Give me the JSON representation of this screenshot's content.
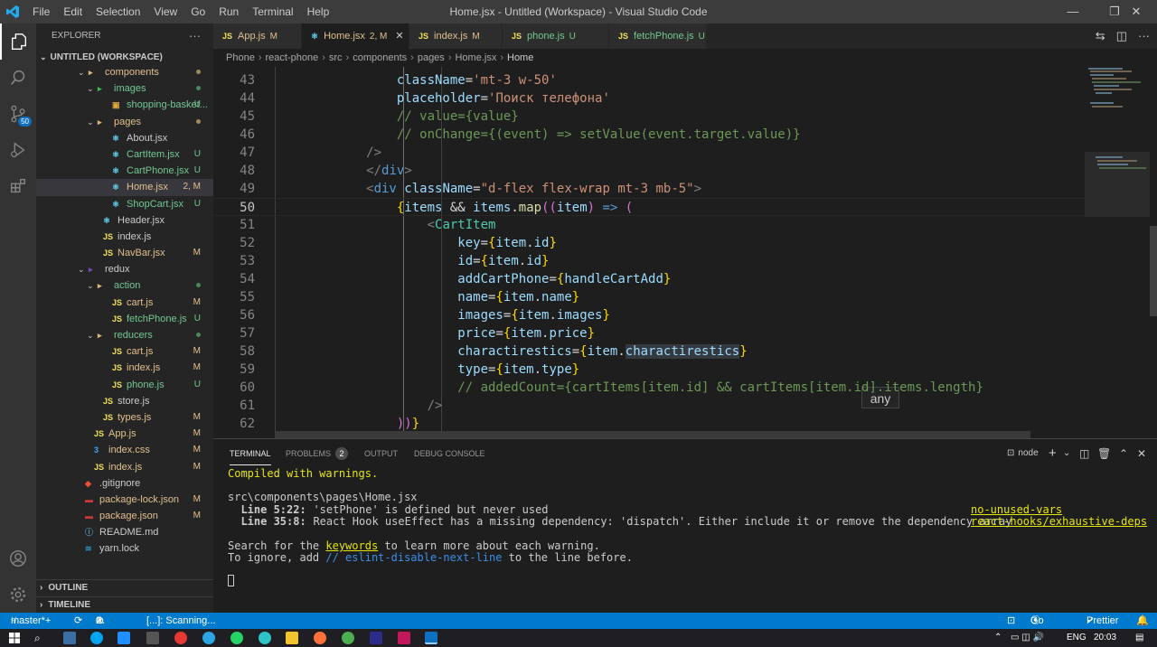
{
  "titlebar": {
    "menu": [
      "File",
      "Edit",
      "Selection",
      "View",
      "Go",
      "Run",
      "Terminal",
      "Help"
    ],
    "title": "Home.jsx - Untitled (Workspace) - Visual Studio Code",
    "min": "—",
    "max": "❐",
    "close": "✕"
  },
  "activity": {
    "scm_badge": "50"
  },
  "explorer": {
    "title": "EXPLORER",
    "more": "···",
    "workspace": "UNTITLED (WORKSPACE)",
    "items": [
      {
        "label": "components",
        "type": "folder",
        "icon": "folder",
        "status": "dot-yellow"
      },
      {
        "label": "images",
        "type": "folder",
        "icon": "folder-image",
        "status": "dot-green"
      },
      {
        "label": "shopping-basket...",
        "type": "file",
        "icon": "image-file",
        "status": "U"
      },
      {
        "label": "pages",
        "type": "folder",
        "icon": "folder",
        "status": "dot-yellow"
      },
      {
        "label": "About.jsx",
        "type": "file",
        "icon": "react",
        "status": ""
      },
      {
        "label": "CartItem.jsx",
        "type": "file",
        "icon": "react",
        "status": "U"
      },
      {
        "label": "CartPhone.jsx",
        "type": "file",
        "icon": "react",
        "status": "U"
      },
      {
        "label": "Home.jsx",
        "type": "file",
        "icon": "react",
        "status": "2, M"
      },
      {
        "label": "ShopCart.jsx",
        "type": "file",
        "icon": "react",
        "status": "U"
      },
      {
        "label": "Header.jsx",
        "type": "file",
        "icon": "react",
        "status": ""
      },
      {
        "label": "index.js",
        "type": "file",
        "icon": "js",
        "status": ""
      },
      {
        "label": "NavBar.jsx",
        "type": "file",
        "icon": "js",
        "status": "M"
      },
      {
        "label": "redux",
        "type": "folder",
        "icon": "folder-redux",
        "status": ""
      },
      {
        "label": "action",
        "type": "folder",
        "icon": "folder",
        "status": "dot-green"
      },
      {
        "label": "cart.js",
        "type": "file",
        "icon": "js",
        "status": "M"
      },
      {
        "label": "fetchPhone.js",
        "type": "file",
        "icon": "js",
        "status": "U"
      },
      {
        "label": "reducers",
        "type": "folder",
        "icon": "folder",
        "status": "dot-green"
      },
      {
        "label": "cart.js",
        "type": "file",
        "icon": "js",
        "status": "M"
      },
      {
        "label": "index.js",
        "type": "file",
        "icon": "js",
        "status": "M"
      },
      {
        "label": "phone.js",
        "type": "file",
        "icon": "js",
        "status": "U"
      },
      {
        "label": "store.js",
        "type": "file",
        "icon": "js",
        "status": ""
      },
      {
        "label": "types.js",
        "type": "file",
        "icon": "js",
        "status": "M"
      },
      {
        "label": "App.js",
        "type": "file",
        "icon": "js",
        "status": "M"
      },
      {
        "label": "index.css",
        "type": "file",
        "icon": "css",
        "status": "M"
      },
      {
        "label": "index.js",
        "type": "file",
        "icon": "js",
        "status": "M"
      },
      {
        "label": ".gitignore",
        "type": "file",
        "icon": "git",
        "status": ""
      },
      {
        "label": "package-lock.json",
        "type": "file",
        "icon": "npm",
        "status": "M"
      },
      {
        "label": "package.json",
        "type": "file",
        "icon": "npm",
        "status": "M"
      },
      {
        "label": "README.md",
        "type": "file",
        "icon": "md",
        "status": ""
      },
      {
        "label": "yarn.lock",
        "type": "file",
        "icon": "yarn",
        "status": ""
      }
    ],
    "outline": "OUTLINE",
    "timeline": "TIMELINE"
  },
  "tabs": [
    {
      "label": "App.js",
      "status": "M",
      "icon": "JS"
    },
    {
      "label": "Home.jsx",
      "status": "2, M",
      "icon": "react",
      "active": true
    },
    {
      "label": "index.js",
      "status": "M",
      "icon": "JS"
    },
    {
      "label": "phone.js",
      "status": "U",
      "icon": "JS"
    },
    {
      "label": "fetchPhone.js",
      "status": "U",
      "icon": "JS"
    }
  ],
  "breadcrumb": [
    "Phone",
    "react-phone",
    "src",
    "components",
    "pages",
    "Home.jsx",
    "Home"
  ],
  "editor": {
    "lines": [
      {
        "n": "43",
        "tokens": [
          {
            "t": "                className",
            "c": "attr"
          },
          {
            "t": "=",
            "c": "op"
          },
          {
            "t": "'mt-3 w-50'",
            "c": "str"
          }
        ]
      },
      {
        "n": "44",
        "tokens": [
          {
            "t": "                placeholder",
            "c": "attr"
          },
          {
            "t": "=",
            "c": "op"
          },
          {
            "t": "'Поиск телефона'",
            "c": "str"
          }
        ]
      },
      {
        "n": "45",
        "tokens": [
          {
            "t": "                // value={value}",
            "c": "cmt"
          }
        ]
      },
      {
        "n": "46",
        "tokens": [
          {
            "t": "                // onChange={(event) => setValue(event.target.value)}",
            "c": "cmt"
          }
        ]
      },
      {
        "n": "47",
        "tokens": [
          {
            "t": "            />",
            "c": "tag"
          }
        ]
      },
      {
        "n": "48",
        "tokens": [
          {
            "t": "            </",
            "c": "tag"
          },
          {
            "t": "div",
            "c": "tagname"
          },
          {
            "t": ">",
            "c": "tag"
          }
        ]
      },
      {
        "n": "49",
        "tokens": [
          {
            "t": "            <",
            "c": "tag"
          },
          {
            "t": "div",
            "c": "tagname"
          },
          {
            "t": " className",
            "c": "attr"
          },
          {
            "t": "=",
            "c": "op"
          },
          {
            "t": "\"d-flex flex-wrap mt-3 mb-5\"",
            "c": "str"
          },
          {
            "t": ">",
            "c": "tag"
          }
        ]
      },
      {
        "n": "50",
        "cur": true,
        "tokens": [
          {
            "t": "                {",
            "c": "brace"
          },
          {
            "t": "items",
            "c": "var"
          },
          {
            "t": " && ",
            "c": "op"
          },
          {
            "t": "items",
            "c": "var"
          },
          {
            "t": ".",
            "c": "op"
          },
          {
            "t": "map",
            "c": "fn"
          },
          {
            "t": "((",
            "c": "paren"
          },
          {
            "t": "item",
            "c": "var"
          },
          {
            "t": ")",
            "c": "paren"
          },
          {
            "t": " => ",
            "c": "kw"
          },
          {
            "t": "(",
            "c": "paren"
          }
        ]
      },
      {
        "n": "51",
        "tokens": [
          {
            "t": "                    <",
            "c": "tag"
          },
          {
            "t": "CartItem",
            "c": "comp"
          }
        ]
      },
      {
        "n": "52",
        "tokens": [
          {
            "t": "                        key",
            "c": "attr"
          },
          {
            "t": "=",
            "c": "op"
          },
          {
            "t": "{",
            "c": "brace"
          },
          {
            "t": "item",
            "c": "var"
          },
          {
            "t": ".",
            "c": "op"
          },
          {
            "t": "id",
            "c": "var"
          },
          {
            "t": "}",
            "c": "brace"
          }
        ]
      },
      {
        "n": "53",
        "tokens": [
          {
            "t": "                        id",
            "c": "attr"
          },
          {
            "t": "=",
            "c": "op"
          },
          {
            "t": "{",
            "c": "brace"
          },
          {
            "t": "item",
            "c": "var"
          },
          {
            "t": ".",
            "c": "op"
          },
          {
            "t": "id",
            "c": "var"
          },
          {
            "t": "}",
            "c": "brace"
          }
        ]
      },
      {
        "n": "54",
        "tokens": [
          {
            "t": "                        addCartPhone",
            "c": "attr"
          },
          {
            "t": "=",
            "c": "op"
          },
          {
            "t": "{",
            "c": "brace"
          },
          {
            "t": "handleCartAdd",
            "c": "var"
          },
          {
            "t": "}",
            "c": "brace"
          }
        ]
      },
      {
        "n": "55",
        "tokens": [
          {
            "t": "                        name",
            "c": "attr"
          },
          {
            "t": "=",
            "c": "op"
          },
          {
            "t": "{",
            "c": "brace"
          },
          {
            "t": "item",
            "c": "var"
          },
          {
            "t": ".",
            "c": "op"
          },
          {
            "t": "name",
            "c": "var"
          },
          {
            "t": "}",
            "c": "brace"
          }
        ]
      },
      {
        "n": "56",
        "tokens": [
          {
            "t": "                        images",
            "c": "attr"
          },
          {
            "t": "=",
            "c": "op"
          },
          {
            "t": "{",
            "c": "brace"
          },
          {
            "t": "item",
            "c": "var"
          },
          {
            "t": ".",
            "c": "op"
          },
          {
            "t": "images",
            "c": "var"
          },
          {
            "t": "}",
            "c": "brace"
          }
        ]
      },
      {
        "n": "57",
        "tokens": [
          {
            "t": "                        price",
            "c": "attr"
          },
          {
            "t": "=",
            "c": "op"
          },
          {
            "t": "{",
            "c": "brace"
          },
          {
            "t": "item",
            "c": "var"
          },
          {
            "t": ".",
            "c": "op"
          },
          {
            "t": "price",
            "c": "var"
          },
          {
            "t": "}",
            "c": "brace"
          }
        ]
      },
      {
        "n": "58",
        "tokens": [
          {
            "t": "                        charactirestics",
            "c": "attr"
          },
          {
            "t": "=",
            "c": "op"
          },
          {
            "t": "{",
            "c": "brace"
          },
          {
            "t": "item",
            "c": "var"
          },
          {
            "t": ".",
            "c": "op"
          },
          {
            "t": "charactirestics",
            "c": "hl"
          },
          {
            "t": "}",
            "c": "brace"
          }
        ]
      },
      {
        "n": "59",
        "tokens": [
          {
            "t": "                        type",
            "c": "attr"
          },
          {
            "t": "=",
            "c": "op"
          },
          {
            "t": "{",
            "c": "brace"
          },
          {
            "t": "item",
            "c": "var"
          },
          {
            "t": ".",
            "c": "op"
          },
          {
            "t": "type",
            "c": "var"
          },
          {
            "t": "}",
            "c": "brace"
          }
        ]
      },
      {
        "n": "60",
        "tokens": [
          {
            "t": "                        // addedCount={cartItems[item.id] && cartItems[item.id].items.length}",
            "c": "cmt"
          }
        ]
      },
      {
        "n": "61",
        "tokens": [
          {
            "t": "                    />",
            "c": "tag"
          }
        ]
      },
      {
        "n": "62",
        "tokens": [
          {
            "t": "                ",
            "c": "op"
          },
          {
            "t": "))",
            "c": "paren"
          },
          {
            "t": "}",
            "c": "brace"
          }
        ]
      }
    ],
    "hover": "any"
  },
  "panel": {
    "tabs": [
      "TERMINAL",
      "PROBLEMS",
      "OUTPUT",
      "DEBUG CONSOLE"
    ],
    "problems_count": "2",
    "shell": "node",
    "terminal": {
      "l1": "Compiled with warnings.",
      "l2": "src\\components\\pages\\Home.jsx",
      "l3a": "  Line 5:22:",
      "l3b": "  'setPhone' is defined but never used",
      "l3c": "no-unused-vars",
      "l4a": "  Line 35:8:",
      "l4b": "  React Hook useEffect has a missing dependency: 'dispatch'. Either include it or remove the dependency array",
      "l4c": "react-hooks/exhaustive-deps",
      "l5a": "Search for the ",
      "l5b": "keywords",
      "l5c": " to learn more about each warning.",
      "l6a": "To ignore, add ",
      "l6b": "// eslint-disable-next-line",
      "l6c": " to the line before."
    }
  },
  "statusbar": {
    "branch": "master*+",
    "errors": "0",
    "warnings": "2",
    "scanning": "[...]: Scanning...",
    "golive": "Go Live",
    "prettier": "Prettier"
  },
  "taskbar": {
    "lang": "ENG",
    "time": "20:03"
  },
  "colors": {
    "accent": "#007acc",
    "attr": "#9cdcfe",
    "str": "#ce9178",
    "cmt": "#6a9955",
    "tag": "#808080",
    "tagname": "#569cd6",
    "comp": "#4ec9b0",
    "fn": "#dcdcaa",
    "kw": "#569cd6",
    "brace": "#ffd700",
    "paren": "#da70d6"
  }
}
